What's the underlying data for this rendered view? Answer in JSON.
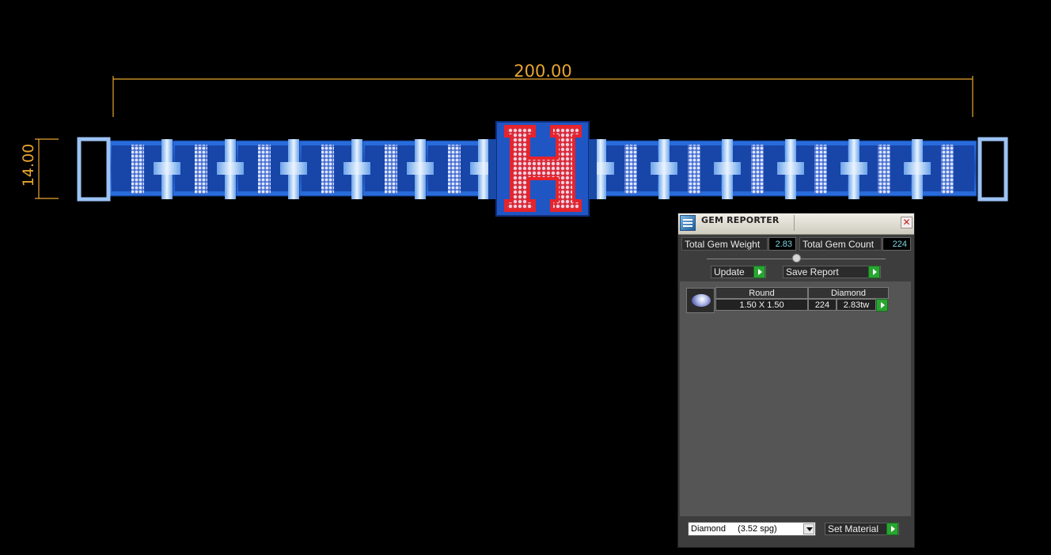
{
  "dimensions": {
    "width_text": "200.00",
    "height_text": "14.00"
  },
  "colors": {
    "dimension": "#e8a630",
    "metal_blue": "#1f5fc9",
    "letter_red": "#e8232b"
  },
  "bracelet": {
    "center_letter": "H"
  },
  "gem_reporter": {
    "title": "GEM REPORTER",
    "total_weight_label": "Total Gem Weight",
    "total_weight_value": "2.83",
    "total_count_label": "Total Gem Count",
    "total_count_value": "224",
    "update_label": "Update",
    "save_report_label": "Save Report",
    "table": {
      "shape": "Round",
      "material": "Diamond",
      "size": "1.50 X 1.50",
      "count": "224",
      "weight": "2.83tw"
    },
    "material_select": {
      "value": "Diamond",
      "spg": "(3.52 spg)"
    },
    "set_material_label": "Set Material"
  }
}
